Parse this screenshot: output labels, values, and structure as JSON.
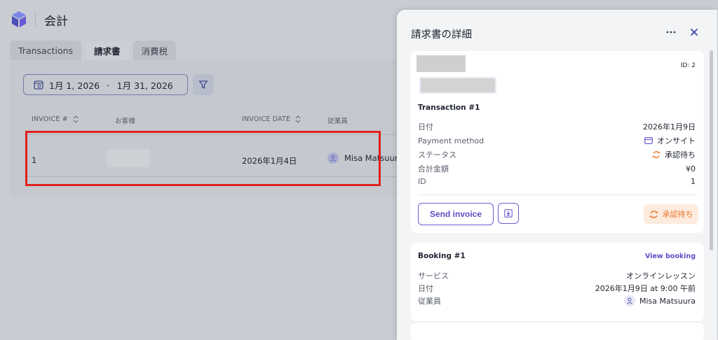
{
  "app": {
    "title": "会計"
  },
  "tabs": [
    {
      "label": "Transactions",
      "active": false
    },
    {
      "label": "請求書",
      "active": true
    },
    {
      "label": "消費税",
      "active": false
    }
  ],
  "filters": {
    "date_from": "1月 1, 2026",
    "separator": "-",
    "date_to": "1月 31, 2026"
  },
  "table": {
    "headers": {
      "invoice": "INVOICE #",
      "customer": "お客様",
      "date": "INVOICE DATE",
      "employee": "従業員"
    },
    "rows": [
      {
        "invoice": "1",
        "customer": "",
        "date": "2026年1月4日",
        "employee": "Misa Matsuura"
      }
    ]
  },
  "panel": {
    "title": "請求書の詳細",
    "id_label": "ID: 2",
    "transaction": {
      "title": "Transaction #1",
      "fields": [
        {
          "key": "日付",
          "value": "2026年1月9日"
        },
        {
          "key": "Payment method",
          "value": "オンサイト"
        },
        {
          "key": "ステータス",
          "value": "承認待ち"
        },
        {
          "key": "合計金額",
          "value": "¥0"
        },
        {
          "key": "ID",
          "value": "1"
        }
      ],
      "send_label": "Send invoice",
      "status_button": "承認待ち"
    },
    "booking": {
      "title": "Booking #1",
      "link": "View booking",
      "fields": [
        {
          "key": "サービス",
          "value": "オンラインレッスン"
        },
        {
          "key": "日付",
          "value": "2026年1月9日 at 9:00 午前"
        },
        {
          "key": "従業員",
          "value": "Misa Matsuura"
        }
      ]
    }
  },
  "colors": {
    "accent": "#5b4fc6",
    "warning": "#e8742a",
    "highlight": "#e02020"
  }
}
